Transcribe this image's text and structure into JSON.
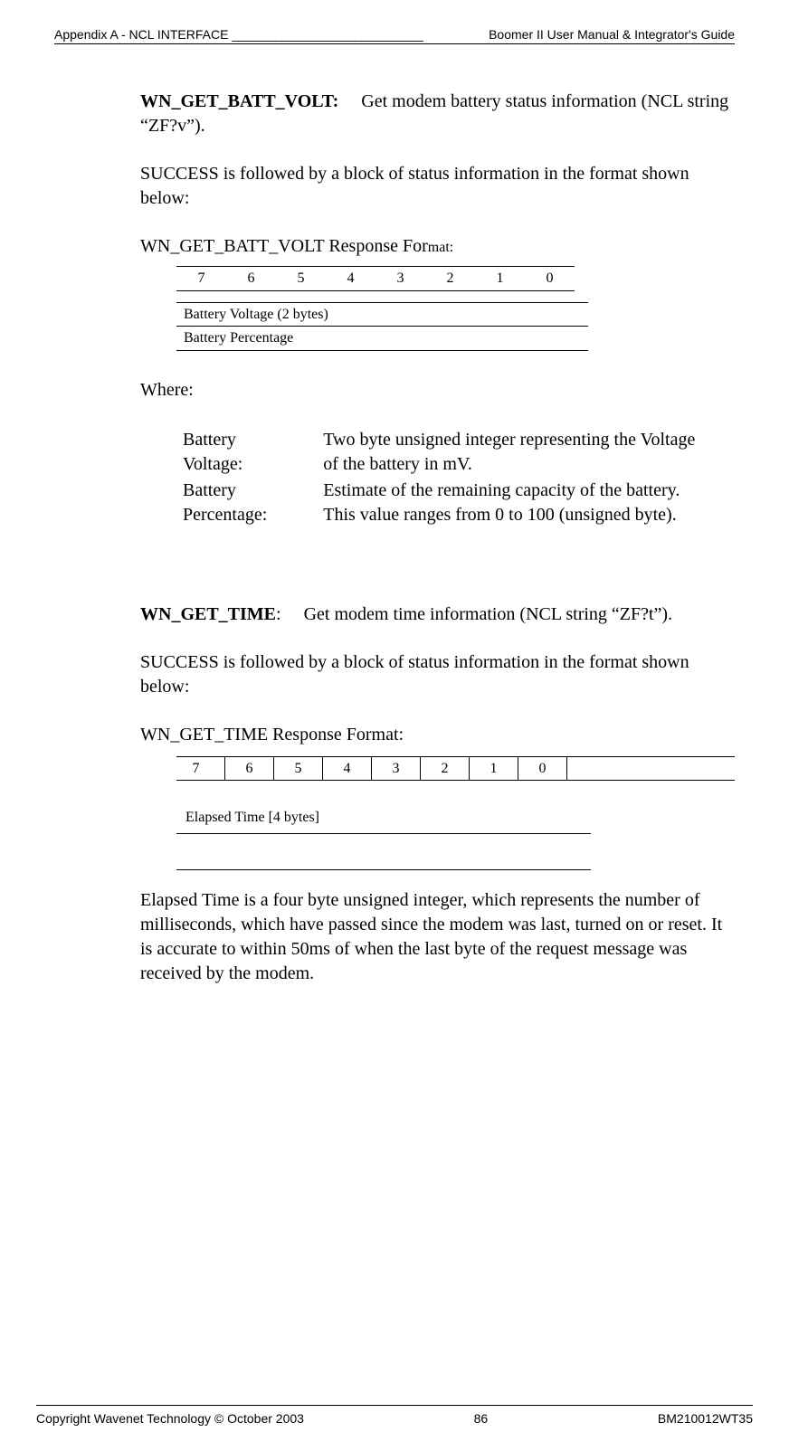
{
  "header": {
    "left": "Appendix A - NCL INTERFACE",
    "separator": "_______________________________",
    "right": "Boomer II User Manual & Integrator's Guide"
  },
  "section1": {
    "cmdName": "WN_GET_BATT_VOLT:",
    "cmdDesc": "Get modem battery status information (NCL string “ZF?v”).",
    "successText": "SUCCESS is followed by a block of status information in the format shown below:",
    "formatLabel": "WN_GET_BATT_VOLT Response For",
    "formatLabelSuffix": "mat:",
    "bitHeaders": [
      "7",
      "6",
      "5",
      "4",
      "3",
      "2",
      "1",
      "0"
    ],
    "dataRow1": "Battery Voltage (2 bytes)",
    "dataRow2": "Battery Percentage",
    "whereLabel": "Where:",
    "field1Label": "Battery Voltage:",
    "field1Desc": "Two byte unsigned integer representing the Voltage of the battery in mV.",
    "field2Label": "Battery Percentage:",
    "field2Desc": "Estimate of the remaining capacity of the battery.  This value ranges from 0 to 100 (unsigned byte)."
  },
  "section2": {
    "cmdName": "WN_GET_TIME",
    "cmdColon": ":",
    "cmdDesc": "Get modem time information (NCL string “ZF?t”).",
    "successText": "SUCCESS is followed by a block of status information in the format shown below:",
    "formatLabel": "WN_GET_TIME Response Format:",
    "bitHeaders": [
      "7",
      "6",
      "5",
      "4",
      "3",
      "2",
      "1",
      "0"
    ],
    "dataRow1": "Elapsed Time [4 bytes]",
    "explanation": "Elapsed Time is a four byte unsigned integer, which represents the number of milliseconds, which have passed since the modem was last, turned on or reset.  It is accurate to within 50ms of when the last byte of the request message was received by the modem."
  },
  "footer": {
    "left": "Copyright Wavenet Technology © October 2003",
    "center": "86",
    "right": "BM210012WT35"
  }
}
